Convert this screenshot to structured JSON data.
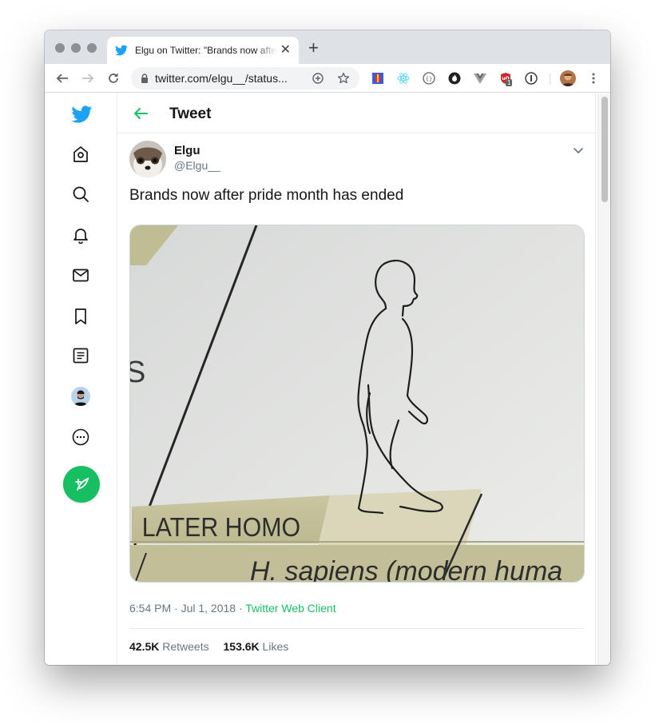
{
  "browser": {
    "tab_title": "Elgu on Twitter: \"Brands now after pride month has ended\"",
    "url": "twitter.com/elgu__/status...",
    "extension_badge": "1",
    "icons": {
      "back": "back-arrow-icon",
      "forward": "forward-arrow-icon",
      "reload": "reload-icon",
      "lock": "lock-icon",
      "add": "add-circle-icon",
      "bookmark": "star-icon",
      "menu": "kebab-menu-icon"
    }
  },
  "sidebar": {
    "items": [
      {
        "name": "twitter-logo-icon",
        "label": "Twitter"
      },
      {
        "name": "home-icon",
        "label": "Home"
      },
      {
        "name": "explore-icon",
        "label": "Explore"
      },
      {
        "name": "notifications-icon",
        "label": "Notifications"
      },
      {
        "name": "messages-icon",
        "label": "Messages"
      },
      {
        "name": "bookmarks-icon",
        "label": "Bookmarks"
      },
      {
        "name": "lists-icon",
        "label": "Lists"
      },
      {
        "name": "profile-avatar",
        "label": "Profile"
      },
      {
        "name": "more-icon",
        "label": "More"
      }
    ],
    "compose_icon": "compose-feather-icon"
  },
  "header": {
    "title": "Tweet"
  },
  "tweet": {
    "display_name": "Elgu",
    "handle": "@Elgu__",
    "text": "Brands now after pride month has ended",
    "image_text": {
      "stray_letter": "S",
      "label": "LATER HOMO",
      "caption": "H. sapiens (modern huma"
    },
    "timestamp": "6:54 PM · Jul 1, 2018 · ",
    "source": "Twitter Web Client",
    "retweets_count": "42.5K",
    "retweets_label": "Retweets",
    "likes_count": "153.6K",
    "likes_label": "Likes"
  },
  "colors": {
    "accent": "#17bf63",
    "twitter_blue": "#1da1f2",
    "text_primary": "#14171a",
    "text_secondary": "#657786",
    "border": "#e6ecf0"
  }
}
